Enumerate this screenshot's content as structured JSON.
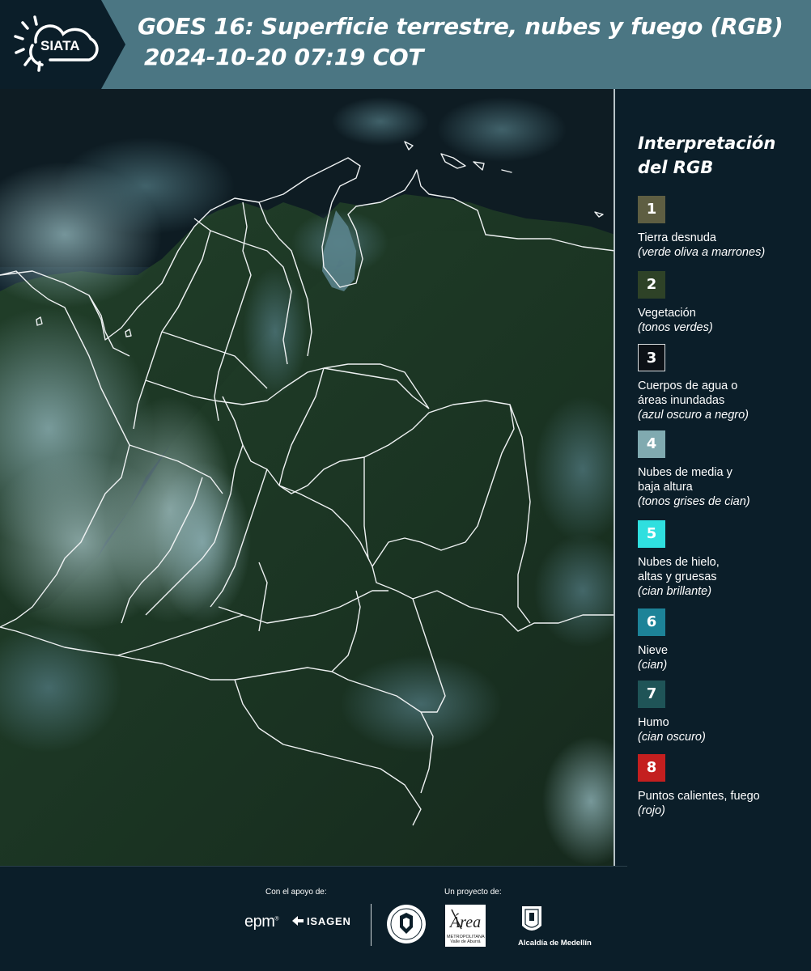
{
  "header": {
    "logo_text": "SIATA",
    "title_line1": "GOES 16: Superficie terrestre, nubes y fuego (RGB)",
    "title_line2": "2024-10-20 07:19 COT",
    "bg_color": "#4b7683",
    "logo_bg_color": "#0b1e29"
  },
  "legend": {
    "title_line1": "Interpretación",
    "title_line2": "del RGB",
    "items": [
      {
        "num": "1",
        "label": "Tierra desnuda",
        "label2": "",
        "sub": "(verde oliva a marrones)",
        "color": "#5e5e42"
      },
      {
        "num": "2",
        "label": "Vegetación",
        "label2": "",
        "sub": "(tonos verdes)",
        "color": "#2e4227"
      },
      {
        "num": "3",
        "label": "Cuerpos de agua o",
        "label2": "áreas inundadas",
        "sub": "(azul oscuro a negro)",
        "color": "#0c1116"
      },
      {
        "num": "4",
        "label": "Nubes de media y",
        "label2": "baja altura",
        "sub": "(tonos grises de cian)",
        "color": "#80aab0"
      },
      {
        "num": "5",
        "label": "Nubes de hielo,",
        "label2": "altas y gruesas",
        "sub": "(cian brillante)",
        "color": "#2fdfdf"
      },
      {
        "num": "6",
        "label": "Nieve",
        "label2": "",
        "sub": "(cian)",
        "color": "#1d8398"
      },
      {
        "num": "7",
        "label": "Humo",
        "label2": "",
        "sub": "(cian oscuro)",
        "color": "#1f5457"
      },
      {
        "num": "8",
        "label": "Puntos calientes, fuego",
        "label2": "",
        "sub": "(rojo)",
        "color": "#c41f1f"
      }
    ]
  },
  "footer": {
    "support_label": "Con el apoyo de:",
    "project_label": "Un proyecto de:",
    "epm": "epm",
    "isagen": "ISAGEN",
    "metro_text": "METROPOLITANA Valle de Aburrá",
    "metro_logo": "Área",
    "alcaldia": "Alcaldía de Medellín"
  },
  "map": {
    "land_color": "#1b3322",
    "sea_color": "#0f1d24",
    "cloud_color": "#6f9aa2",
    "border_color": "#e8ecee"
  }
}
